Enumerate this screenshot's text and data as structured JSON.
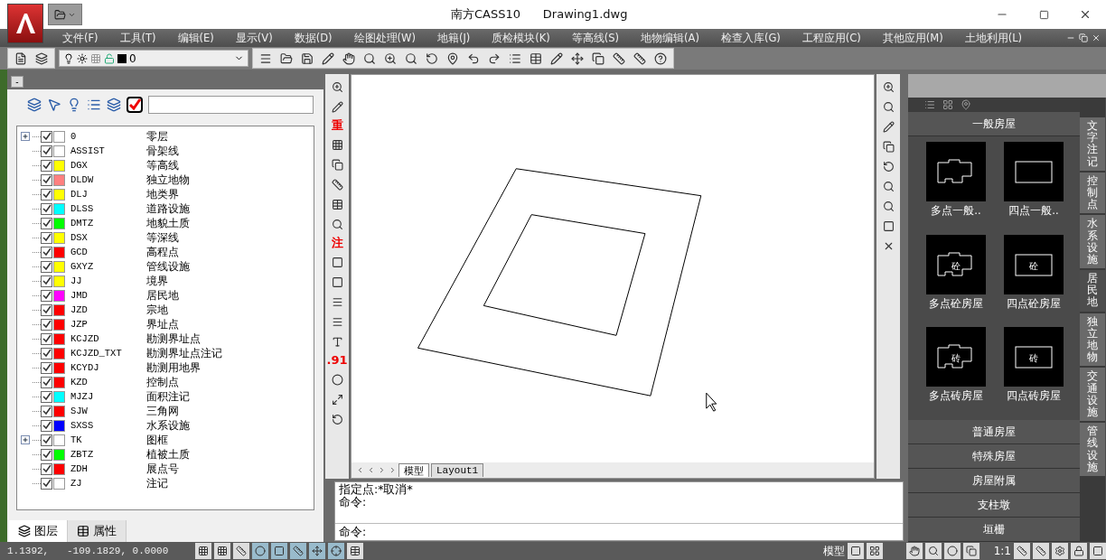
{
  "window": {
    "app": "南方CASS10",
    "document": "Drawing1.dwg"
  },
  "menus": [
    {
      "label": "文件(F)"
    },
    {
      "label": "工具(T)"
    },
    {
      "label": "编辑(E)"
    },
    {
      "label": "显示(V)"
    },
    {
      "label": "数据(D)"
    },
    {
      "label": "绘图处理(W)"
    },
    {
      "label": "地籍(J)"
    },
    {
      "label": "质检模块(K)"
    },
    {
      "label": "等高线(S)"
    },
    {
      "label": "地物编辑(A)"
    },
    {
      "label": "检查入库(G)"
    },
    {
      "label": "工程应用(C)"
    },
    {
      "label": "其他应用(M)"
    },
    {
      "label": "土地利用(L)"
    }
  ],
  "layer_toolbar": {
    "current_layer": "0"
  },
  "layer_panel": {
    "collapse": "-",
    "layers": [
      {
        "name": "0",
        "description": "零层",
        "color": "#ffffff",
        "checked": true,
        "expandable": true
      },
      {
        "name": "ASSIST",
        "description": "骨架线",
        "color": "#ffffff",
        "checked": true,
        "expandable": false
      },
      {
        "name": "DGX",
        "description": "等高线",
        "color": "#ffff00",
        "checked": true,
        "expandable": false
      },
      {
        "name": "DLDW",
        "description": "独立地物",
        "color": "#ff8080",
        "checked": true,
        "expandable": false
      },
      {
        "name": "DLJ",
        "description": "地类界",
        "color": "#ffff00",
        "checked": true,
        "expandable": false
      },
      {
        "name": "DLSS",
        "description": "道路设施",
        "color": "#00ffff",
        "checked": true,
        "expandable": false
      },
      {
        "name": "DMTZ",
        "description": "地貌土质",
        "color": "#00ff00",
        "checked": true,
        "expandable": false
      },
      {
        "name": "DSX",
        "description": "等深线",
        "color": "#ffff00",
        "checked": true,
        "expandable": false
      },
      {
        "name": "GCD",
        "description": "高程点",
        "color": "#ff0000",
        "checked": true,
        "expandable": false
      },
      {
        "name": "GXYZ",
        "description": "管线设施",
        "color": "#ffff00",
        "checked": true,
        "expandable": false
      },
      {
        "name": "JJ",
        "description": "境界",
        "color": "#ffff00",
        "checked": true,
        "expandable": false
      },
      {
        "name": "JMD",
        "description": "居民地",
        "color": "#ff00ff",
        "checked": true,
        "expandable": false
      },
      {
        "name": "JZD",
        "description": "宗地",
        "color": "#ff0000",
        "checked": true,
        "expandable": false
      },
      {
        "name": "JZP",
        "description": "界址点",
        "color": "#ff0000",
        "checked": true,
        "expandable": false
      },
      {
        "name": "KCJZD",
        "description": "勘测界址点",
        "color": "#ff0000",
        "checked": true,
        "expandable": false
      },
      {
        "name": "KCJZD_TXT",
        "description": "勘测界址点注记",
        "color": "#ff0000",
        "checked": true,
        "expandable": false
      },
      {
        "name": "KCYDJ",
        "description": "勘测用地界",
        "color": "#ff0000",
        "checked": true,
        "expandable": false
      },
      {
        "name": "KZD",
        "description": "控制点",
        "color": "#ff0000",
        "checked": true,
        "expandable": false
      },
      {
        "name": "MJZJ",
        "description": "面积注记",
        "color": "#00ffff",
        "checked": true,
        "expandable": false
      },
      {
        "name": "SJW",
        "description": "三角网",
        "color": "#ff0000",
        "checked": true,
        "expandable": false
      },
      {
        "name": "SXSS",
        "description": "水系设施",
        "color": "#0000ff",
        "checked": true,
        "expandable": false
      },
      {
        "name": "TK",
        "description": "图框",
        "color": "#ffffff",
        "checked": true,
        "expandable": true
      },
      {
        "name": "ZBTZ",
        "description": "植被土质",
        "color": "#00ff00",
        "checked": true,
        "expandable": false
      },
      {
        "name": "ZDH",
        "description": "展点号",
        "color": "#ff0000",
        "checked": true,
        "expandable": false
      },
      {
        "name": "ZJ",
        "description": "注记",
        "color": "#ffffff",
        "checked": true,
        "expandable": false
      }
    ],
    "tabs": [
      {
        "label": "图层",
        "selected": true
      },
      {
        "label": "属性",
        "selected": false
      }
    ]
  },
  "left_toolbar_glyphs": [
    "重",
    "注",
    ".91"
  ],
  "drawing": {
    "tabs": [
      {
        "label": "模型",
        "selected": true
      },
      {
        "label": "Layout1",
        "selected": false
      }
    ]
  },
  "command": {
    "history": [
      "指定点:*取消*",
      "命令:"
    ],
    "prompt": "命令:"
  },
  "palette": {
    "open_section": "一般房屋",
    "items": [
      {
        "label": "多点一般..",
        "kind": "multi"
      },
      {
        "label": "四点一般..",
        "kind": "rect"
      },
      {
        "label": "多点砼房屋",
        "kind": "multi",
        "mark": "砼"
      },
      {
        "label": "四点砼房屋",
        "kind": "rect",
        "mark": "砼"
      },
      {
        "label": "多点砖房屋",
        "kind": "multi",
        "mark": "砖"
      },
      {
        "label": "四点砖房屋",
        "kind": "rect",
        "mark": "砖"
      }
    ],
    "sections": [
      "普通房屋",
      "特殊房屋",
      "房屋附属",
      "支柱墩",
      "垣栅"
    ],
    "side_tabs": [
      {
        "label": "文字注记",
        "selected": false
      },
      {
        "label": "控制点",
        "selected": false
      },
      {
        "label": "水系设施",
        "selected": false
      },
      {
        "label": "居民地",
        "selected": true
      },
      {
        "label": "独立地物",
        "selected": false
      },
      {
        "label": "交通设施",
        "selected": false
      },
      {
        "label": "管线设施",
        "selected": false
      }
    ]
  },
  "status_bar": {
    "coordinates": "1.1392,   -109.1829, 0.0000",
    "space": "模型",
    "scale": "1:1"
  }
}
